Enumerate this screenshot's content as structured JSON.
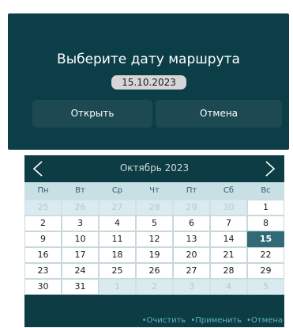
{
  "dialog": {
    "title": "Выберите дату маршрута",
    "date_value": "15.10.2023",
    "open_label": "Открыть",
    "cancel_label": "Отмена"
  },
  "calendar": {
    "month_title": "Октябрь 2023",
    "weekdays": [
      "Пн",
      "Вт",
      "Ср",
      "Чт",
      "Пт",
      "Сб",
      "Вс"
    ],
    "weeks": [
      [
        "25",
        "26",
        "27",
        "28",
        "29",
        "30",
        "1"
      ],
      [
        "2",
        "3",
        "4",
        "5",
        "6",
        "7",
        "8"
      ],
      [
        "9",
        "10",
        "11",
        "12",
        "13",
        "14",
        "15"
      ],
      [
        "16",
        "17",
        "18",
        "19",
        "20",
        "21",
        "22"
      ],
      [
        "23",
        "24",
        "25",
        "26",
        "27",
        "28",
        "29"
      ],
      [
        "30",
        "31",
        "1",
        "2",
        "3",
        "4",
        "5"
      ]
    ],
    "footer": {
      "clear_label": "•Очистить",
      "apply_label": "•Применить",
      "cancel_label": "•Отмена"
    }
  }
}
